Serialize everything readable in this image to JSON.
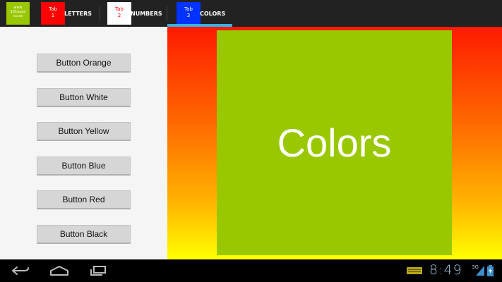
{
  "app": {
    "logo_lines": [
      "www",
      "101apps",
      "co.za"
    ]
  },
  "tabs": [
    {
      "badge_line1": "Tab",
      "badge_line2": "1",
      "label": "LETTERS",
      "badge_bg": "#ff0000",
      "badge_fg": "#ffffff"
    },
    {
      "badge_line1": "Tab",
      "badge_line2": "2",
      "label": "NUMBERS",
      "badge_bg": "#ffffff",
      "badge_fg": "#ff0000"
    },
    {
      "badge_line1": "Tab",
      "badge_line2": "3",
      "label": "COLORS",
      "badge_bg": "#0033ff",
      "badge_fg": "#ffffff",
      "selected": true
    }
  ],
  "buttons": [
    {
      "label": "Button Orange"
    },
    {
      "label": "Button White"
    },
    {
      "label": "Button Yellow"
    },
    {
      "label": "Button Blue"
    },
    {
      "label": "Button Red"
    },
    {
      "label": "Button Black"
    }
  ],
  "content": {
    "title": "Colors",
    "box_color": "#99c800",
    "gradient_colors": [
      "#ff1a00",
      "#ff6600",
      "#ffb300",
      "#ffff00"
    ]
  },
  "status": {
    "time": "8:49",
    "network": "3G"
  },
  "colors": {
    "accent": "#33b5e5",
    "actionbar_bg": "#222222"
  }
}
